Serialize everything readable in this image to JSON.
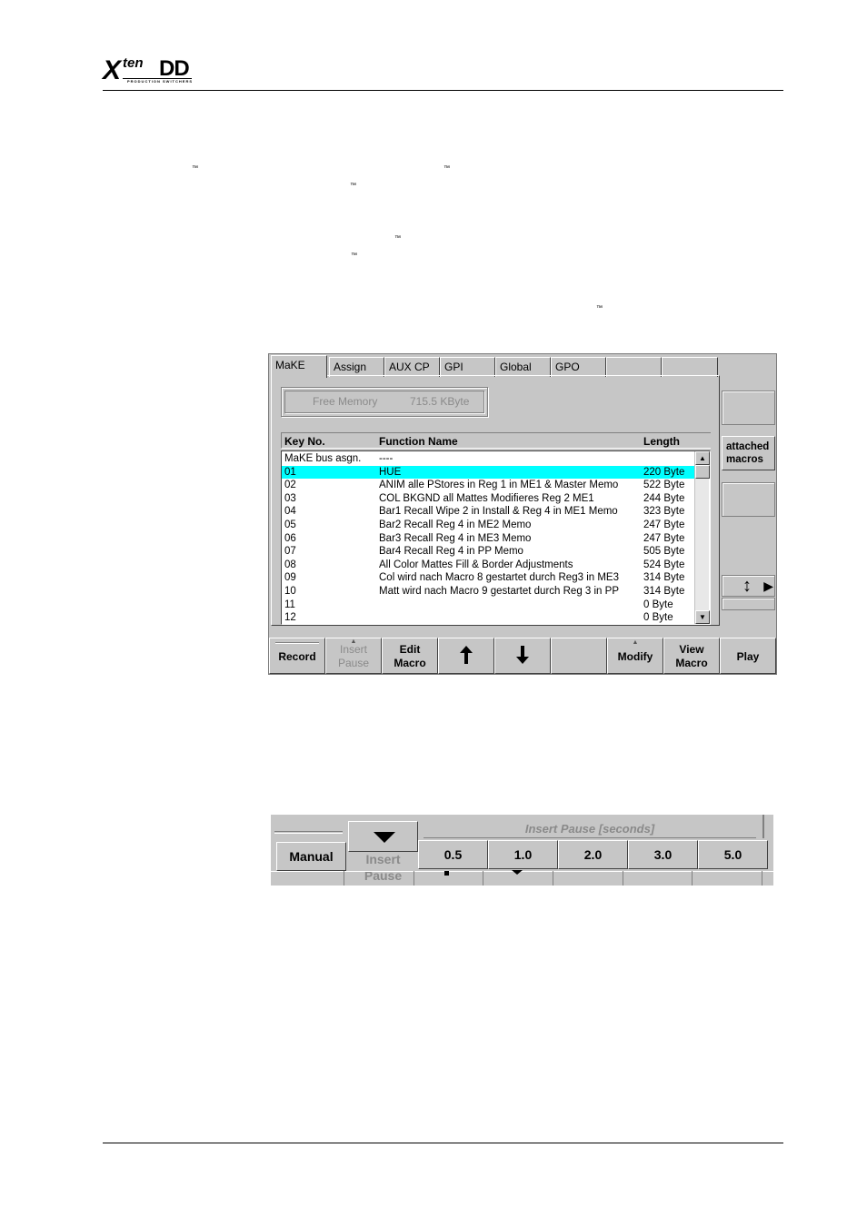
{
  "header": {
    "logo_main": "X",
    "logo_ten": "ten",
    "logo_dd": "DD",
    "logo_sub": "PRODUCTION SWITCHERS",
    "tm_marks": [
      "™",
      "™",
      "™",
      "™",
      "™",
      "™"
    ]
  },
  "panel": {
    "tabs": [
      "MaKE",
      "Assign",
      "AUX CP",
      "GPI",
      "Global",
      "GPO",
      "",
      ""
    ],
    "active_tab": "MaKE",
    "free_memory_label": "Free Memory",
    "free_memory_value": "715.5 KByte",
    "columns": [
      "Key No.",
      "Function Name",
      "Length"
    ],
    "rows": [
      {
        "key": "MaKE bus asgn.",
        "name": "----",
        "length": ""
      },
      {
        "key": "01",
        "name": "HUE",
        "length": "220 Byte"
      },
      {
        "key": "02",
        "name": "ANIM alle PStores in Reg 1 in ME1 & Master Memo",
        "length": "522 Byte"
      },
      {
        "key": "03",
        "name": "COL BKGND all Mattes Modifieres Reg 2 ME1",
        "length": "244 Byte"
      },
      {
        "key": "04",
        "name": "Bar1 Recall Wipe 2 in Install & Reg 4 in ME1 Memo",
        "length": "323 Byte"
      },
      {
        "key": "05",
        "name": "Bar2 Recall Reg 4 in ME2 Memo",
        "length": "247 Byte"
      },
      {
        "key": "06",
        "name": "Bar3 Recall Reg 4 in ME3 Memo",
        "length": "247 Byte"
      },
      {
        "key": "07",
        "name": "Bar4 Recall Reg 4 in PP Memo",
        "length": "505 Byte"
      },
      {
        "key": "08",
        "name": "All Color Mattes Fill & Border Adjustments",
        "length": "524 Byte"
      },
      {
        "key": "09",
        "name": "Col wird nach Macro 8 gestartet durch Reg3 in ME3",
        "length": "314 Byte"
      },
      {
        "key": "10",
        "name": "Matt wird nach Macro 9 gestartet durch Reg 3 in PP",
        "length": "314 Byte"
      },
      {
        "key": "11",
        "name": "",
        "length": "0 Byte"
      },
      {
        "key": "12",
        "name": "",
        "length": "0 Byte"
      }
    ],
    "selected_row": "01",
    "side_button_line1": "attached",
    "side_button_line2": "macros",
    "updown_icon": "↕",
    "right_arrow_icon": "▶",
    "scroll_up_icon": "▲",
    "scroll_down_icon": "▼",
    "buttons": {
      "record": "Record",
      "insert_pause_1": "Insert",
      "insert_pause_2": "Pause",
      "edit_macro_1": "Edit",
      "edit_macro_2": "Macro",
      "up_icon": "🡅",
      "down_icon": "🡇",
      "modify": "Modify",
      "view_macro_1": "View",
      "view_macro_2": "Macro",
      "play": "Play"
    }
  },
  "panel2": {
    "title": "Insert Pause [seconds]",
    "manual": "Manual",
    "insert_1": "Insert",
    "insert_2": "Pause",
    "values": [
      "0.5",
      "1.0",
      "2.0",
      "3.0",
      "5.0"
    ]
  }
}
